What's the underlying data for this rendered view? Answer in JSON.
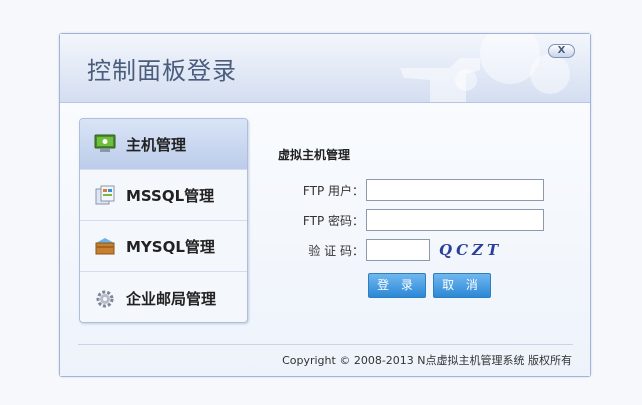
{
  "header": {
    "title": "控制面板登录",
    "close_label": "X"
  },
  "sidebar": {
    "items": [
      {
        "label": "主机管理",
        "icon": "monitor-icon",
        "active": true
      },
      {
        "label": "MSSQL管理",
        "icon": "database-icon",
        "active": false
      },
      {
        "label": "MYSQL管理",
        "icon": "box-icon",
        "active": false
      },
      {
        "label": "企业邮局管理",
        "icon": "gear-icon",
        "active": false
      }
    ]
  },
  "form": {
    "title": "虚拟主机管理",
    "username_label": "FTP 用户：",
    "username_value": "",
    "password_label": "FTP 密码：",
    "password_value": "",
    "captcha_label": "验 证 码：",
    "captcha_value": "",
    "captcha_text": "QCZT",
    "login_label": "登 录",
    "cancel_label": "取 消"
  },
  "footer": {
    "copyright": "Copyright © 2008-2013 N点虚拟主机管理系统 版权所有"
  },
  "colors": {
    "accent": "#2b88d6",
    "header": "#d4def1",
    "title_text": "#4a5d7d"
  }
}
